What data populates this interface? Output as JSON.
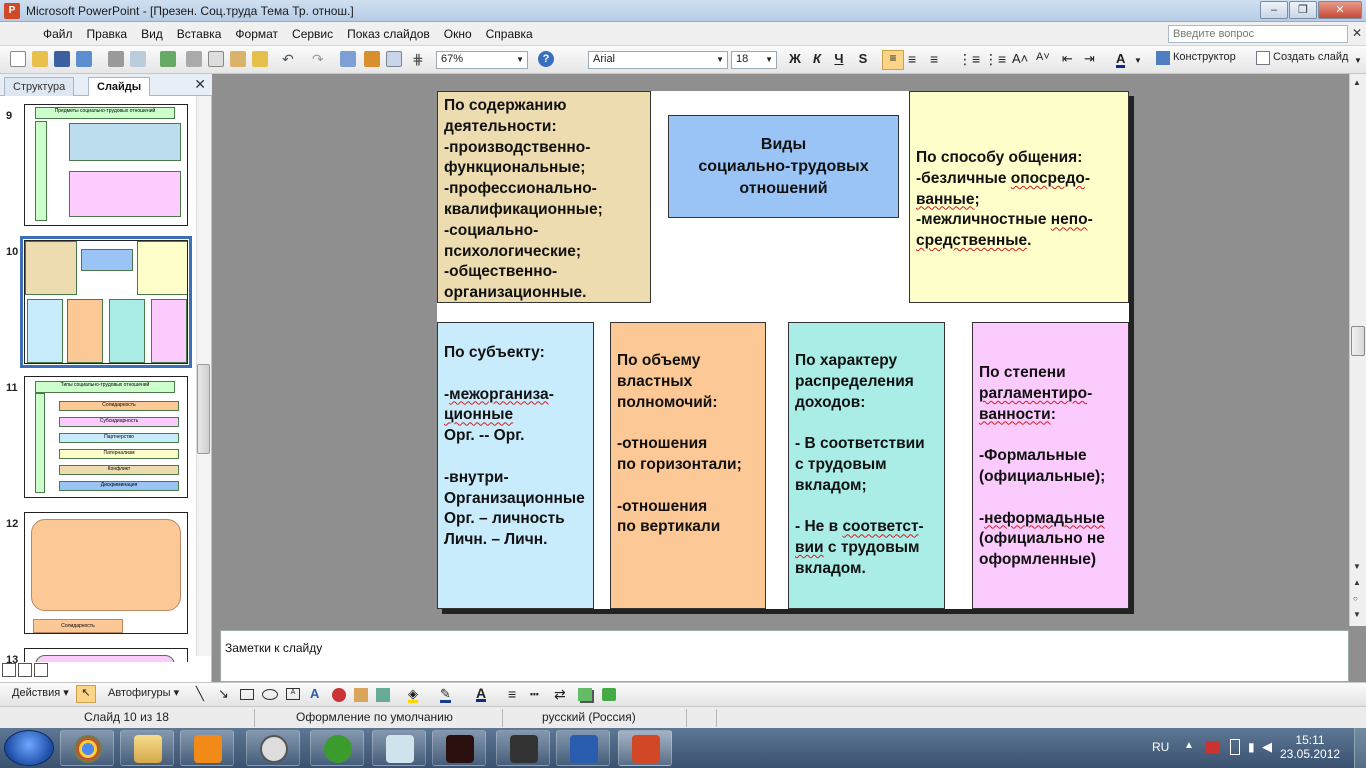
{
  "window": {
    "title": "Microsoft PowerPoint - [Презен. Соц.труда Тема Тр. отнош.]"
  },
  "menu": {
    "items": [
      "Файл",
      "Правка",
      "Вид",
      "Вставка",
      "Формат",
      "Сервис",
      "Показ слайдов",
      "Окно",
      "Справка"
    ],
    "ask_placeholder": "Введите вопрос"
  },
  "toolbar": {
    "zoom": "67%",
    "font": "Arial",
    "size": "18",
    "bold": "Ж",
    "italic": "К",
    "underline": "Ч",
    "shadow": "S",
    "designer": "Конструктор",
    "new_slide": "Создать слайд"
  },
  "left_pane": {
    "tabs": [
      "Структура",
      "Слайды"
    ],
    "slide_numbers": [
      "9",
      "10",
      "11",
      "12",
      "13"
    ],
    "thumb9_title": "Предметы социально-трудовых отношений",
    "thumb11_title": "Типы социально-трудовых отношений",
    "thumb11_items": [
      "Солидарность",
      "Субсидиарность",
      "Партнерство",
      "Патернализм",
      "Конфликт",
      "Дискриминация"
    ],
    "thumb12_label": "Солидарность"
  },
  "slide": {
    "title": "Виды\nсоциально-трудовых\nотношений",
    "box_content": "По содержанию\n деятельности:\n-производственно-\nфункциональные;\n-профессионально-\nквалификационные;\n-социально-\nпсихологические;\n-общественно-\nорганизационные.",
    "box_communication": {
      "p1": "По способу общения:\n-безличные ",
      "w1": "опосредо",
      "p2": "-\n",
      "w2": "ванные",
      "p3": ";\n-межличностные ",
      "w3": "непо",
      "p4": "-\n",
      "w4": "средственные",
      "p5": "."
    },
    "box_subject": {
      "p1": "По субъекту:\n\n-",
      "w1": "межорганиза",
      "p2": "-\n",
      "w2": "ционные",
      "p3": "\nОрг.  --   Орг.\n\n-внутри-\nОрганизационные\nОрг. – личность\nЛичн. – Личн."
    },
    "box_power": "По объему\nвластных\nполномочий:\n\n-отношения\nпо горизонтали;\n\n-отношения\nпо вертикали",
    "box_income": {
      "p1": "По характеру\nраспределения\nдоходов:\n\n- В соответствии\nс трудовым\nвкладом;\n\n- Не в ",
      "w1": "соответст",
      "p2": "-\n",
      "w2": "вии",
      "p3": " с трудовым\nвкладом."
    },
    "box_regulation": {
      "p1": "По степени\n",
      "w1": "рагламентиро",
      "p2": "-\n",
      "w2": "ванности",
      "p3": ":\n\n-Формальные\n(официальные);\n\n-",
      "w3": "неформадьные",
      "p4": "\n(официально не\n оформленные)"
    }
  },
  "notes": {
    "placeholder": "Заметки к слайду"
  },
  "drawbar": {
    "actions": "Действия",
    "autoshapes": "Автофигуры"
  },
  "status": {
    "slide": "Слайд 10 из 18",
    "design": "Оформление по умолчанию",
    "lang": "русский (Россия)"
  },
  "taskbar": {
    "lang": "RU",
    "time": "15:11",
    "date": "23.05.2012"
  },
  "colors": {
    "tan": "#ecdcb0",
    "blue": "#99c4f5",
    "yellow": "#fefecb",
    "lightblue": "#c9ecfd",
    "orange": "#fcc896",
    "teal": "#a9ede6",
    "pink": "#fccbfe"
  }
}
